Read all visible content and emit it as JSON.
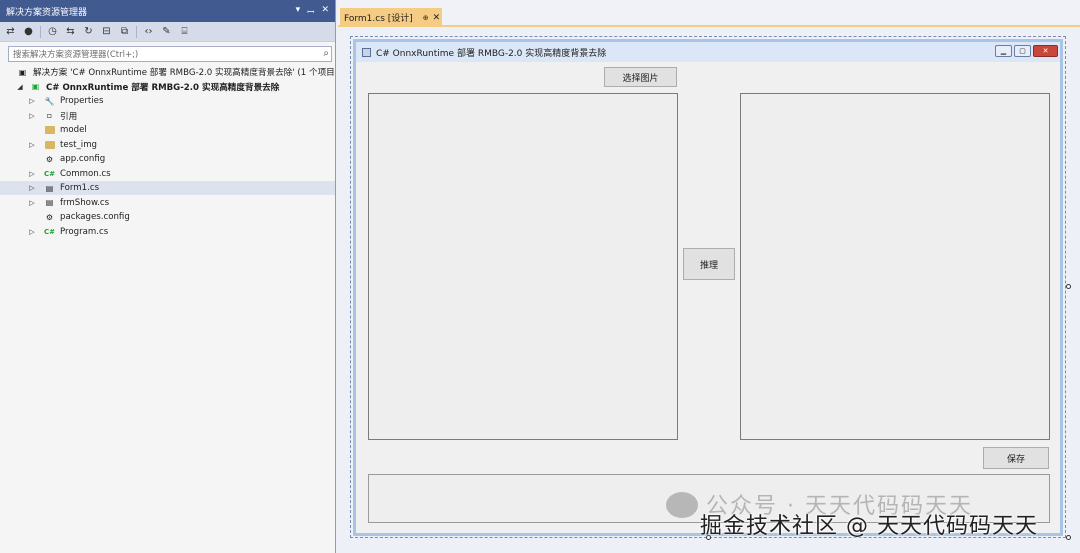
{
  "solution_explorer": {
    "title": "解决方案资源管理器",
    "title_controls": [
      "▾",
      "ꟷ",
      "✕"
    ],
    "search_placeholder": "搜索解决方案资源管理器(Ctrl+;)",
    "items": [
      {
        "label": "解决方案 'C# OnnxRuntime 部署 RMBG-2.0 实现高精度背景去除' (1 个项目",
        "icon": "solution-icon"
      },
      {
        "label": "C# OnnxRuntime 部署 RMBG-2.0 实现高精度背景去除",
        "icon": "csproj-icon"
      },
      {
        "label": "Properties",
        "icon": "wrench-icon"
      },
      {
        "label": "引用",
        "icon": "references-icon"
      },
      {
        "label": "model",
        "icon": "folder-icon"
      },
      {
        "label": "test_img",
        "icon": "folder-icon"
      },
      {
        "label": "app.config",
        "icon": "config-icon"
      },
      {
        "label": "Common.cs",
        "icon": "csharp-file-icon"
      },
      {
        "label": "Form1.cs",
        "icon": "form-icon"
      },
      {
        "label": "frmShow.cs",
        "icon": "form-icon"
      },
      {
        "label": "packages.config",
        "icon": "config-icon"
      },
      {
        "label": "Program.cs",
        "icon": "csharp-file-icon"
      }
    ]
  },
  "editor": {
    "tab_label": "Form1.cs [设计]",
    "tab_pin": "⊕",
    "tab_close": "✕"
  },
  "form": {
    "title": "C# OnnxRuntime 部署 RMBG-2.0 实现高精度背景去除",
    "select_button": "选择图片",
    "infer_button": "推理",
    "save_button": "保存"
  },
  "watermark": {
    "line1": "公众号 · 天天代码码天天",
    "line2": "掘金技术社区 @ 天天代码码天天"
  }
}
